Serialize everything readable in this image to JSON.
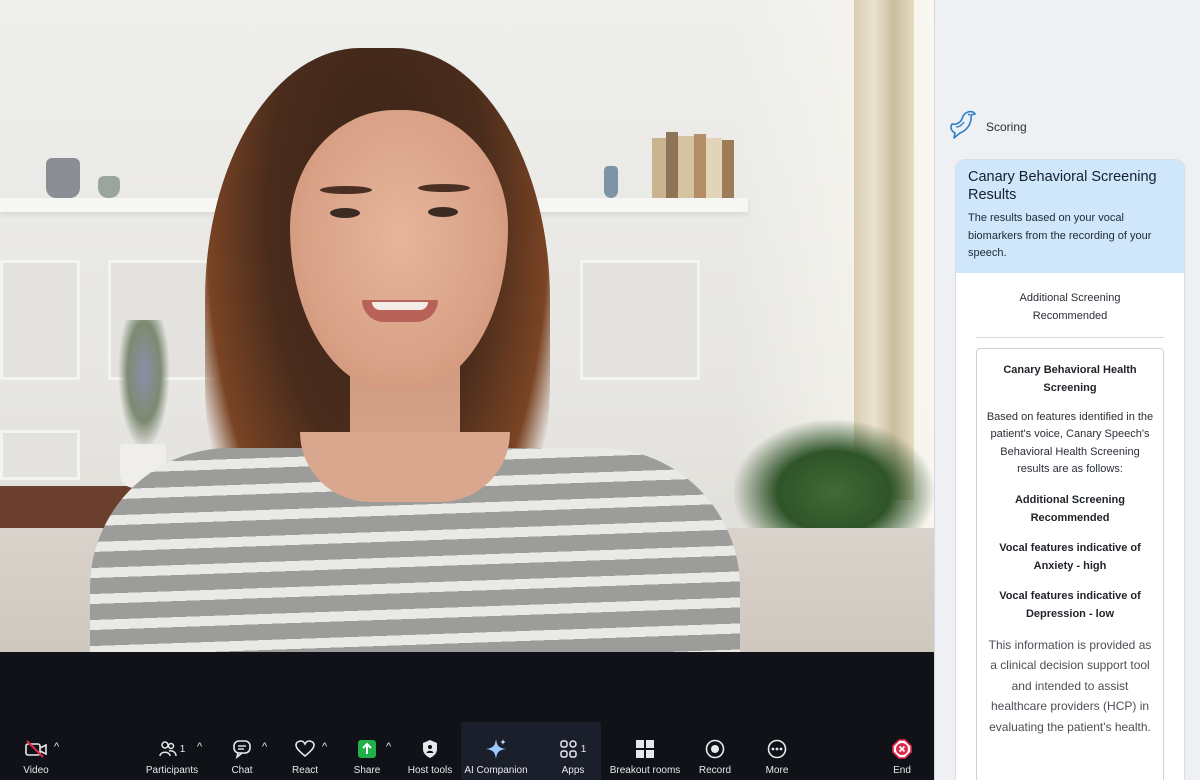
{
  "toolbar": {
    "video": {
      "label": "Video",
      "icon": "video-off-icon"
    },
    "participants": {
      "label": "Participants",
      "count": "1",
      "icon": "participants-icon"
    },
    "chat": {
      "label": "Chat",
      "icon": "chat-icon"
    },
    "react": {
      "label": "React",
      "icon": "heart-icon"
    },
    "share": {
      "label": "Share",
      "icon": "share-screen-icon",
      "color": "#22b04b"
    },
    "host_tools": {
      "label": "Host tools",
      "icon": "shield-icon"
    },
    "ai_companion": {
      "label": "AI Companion",
      "icon": "sparkle-icon"
    },
    "apps": {
      "label": "Apps",
      "count": "1",
      "icon": "apps-icon"
    },
    "breakout_rooms": {
      "label": "Breakout rooms",
      "icon": "grid-icon"
    },
    "record": {
      "label": "Record",
      "icon": "record-icon"
    },
    "more": {
      "label": "More",
      "icon": "more-dots-icon"
    },
    "end": {
      "label": "End",
      "icon": "end-call-icon",
      "color": "#e0284a"
    },
    "caret": "^"
  },
  "panel": {
    "header_title": "Scoring",
    "logo_icon": "canary-bird-icon",
    "card": {
      "title": "Canary Behavioral Screening Results",
      "description": "The results based on your vocal biomarkers from the recording of your speech.",
      "status": "Additional Screening Recommended",
      "detail": {
        "title": "Canary Behavioral Health Screening",
        "intro": "Based on features identified in the patient's voice, Canary Speech's Behavioral Health Screening results are as follows:",
        "result": "Additional Screening Recommended",
        "anxiety": "Vocal features indicative of Anxiety - high",
        "depression": "Vocal features indicative of Depression - low",
        "disclaimer": "This information is provided as a clinical decision support tool and intended to assist healthcare providers (HCP) in evaluating the patient's health."
      }
    }
  }
}
